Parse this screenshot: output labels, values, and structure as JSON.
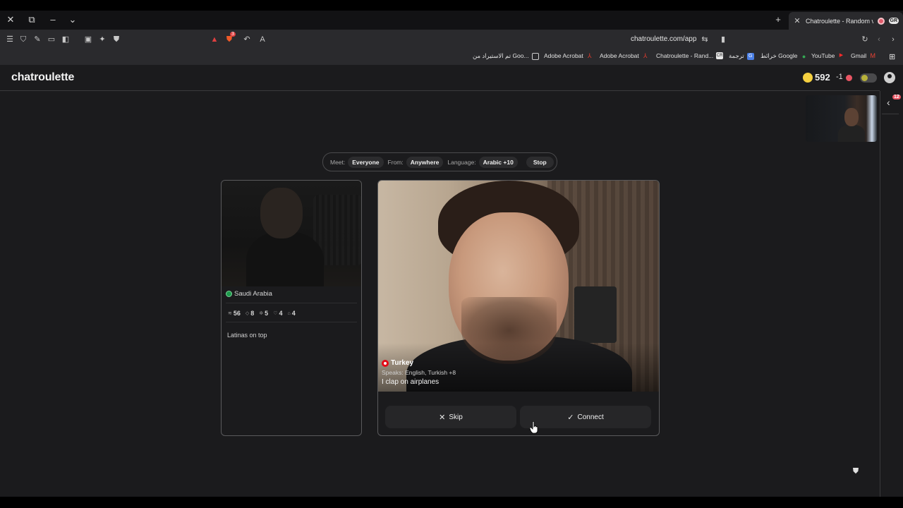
{
  "browser": {
    "tab_title": "Chatroulette - Random video",
    "tab_badge": "GR",
    "url": "chatroulette.com/app",
    "bookmarks": [
      {
        "label": "تم الاستيراد من Goo...",
        "icon": "folder-icon"
      },
      {
        "label": "Adobe Acrobat",
        "icon": "acrobat-icon"
      },
      {
        "label": "Adobe Acrobat",
        "icon": "acrobat-icon"
      },
      {
        "label": "Chatroulette - Rand...",
        "icon": "chatroulette-icon"
      },
      {
        "label": "ترجمة",
        "icon": "translate-icon"
      },
      {
        "label": "خرائط Google",
        "icon": "maps-icon"
      },
      {
        "label": "YouTube",
        "icon": "youtube-icon"
      },
      {
        "label": "Gmail",
        "icon": "gmail-icon"
      }
    ],
    "shield_badge": "3"
  },
  "header": {
    "logo": "chatroulette",
    "coins": "592",
    "coins_delta": "-1"
  },
  "side_panel": {
    "notification_count": "12"
  },
  "filters": {
    "meet_label": "Meet:",
    "meet_value": "Everyone",
    "from_label": "From:",
    "from_value": "Anywhere",
    "language_label": "Language:",
    "language_value": "Arabic +10",
    "stop_label": "Stop"
  },
  "previous_partner": {
    "country": "Saudi Arabia",
    "stats": [
      {
        "icon": "wave-icon",
        "value": "56"
      },
      {
        "icon": "gem-icon",
        "value": "8"
      },
      {
        "icon": "star-icon",
        "value": "5"
      },
      {
        "icon": "heart-icon",
        "value": "4"
      },
      {
        "icon": "gift-icon",
        "value": "4"
      }
    ],
    "bio": "Latinas on top"
  },
  "current_partner": {
    "country": "Turkey",
    "speaks": "Speaks: English, Turkish +8",
    "bio": "I clap on airplanes",
    "skip_label": "Skip",
    "connect_label": "Connect"
  },
  "colors": {
    "background": "#1b1b1d",
    "coin": "#f5d040",
    "accent_red": "#e85563"
  }
}
